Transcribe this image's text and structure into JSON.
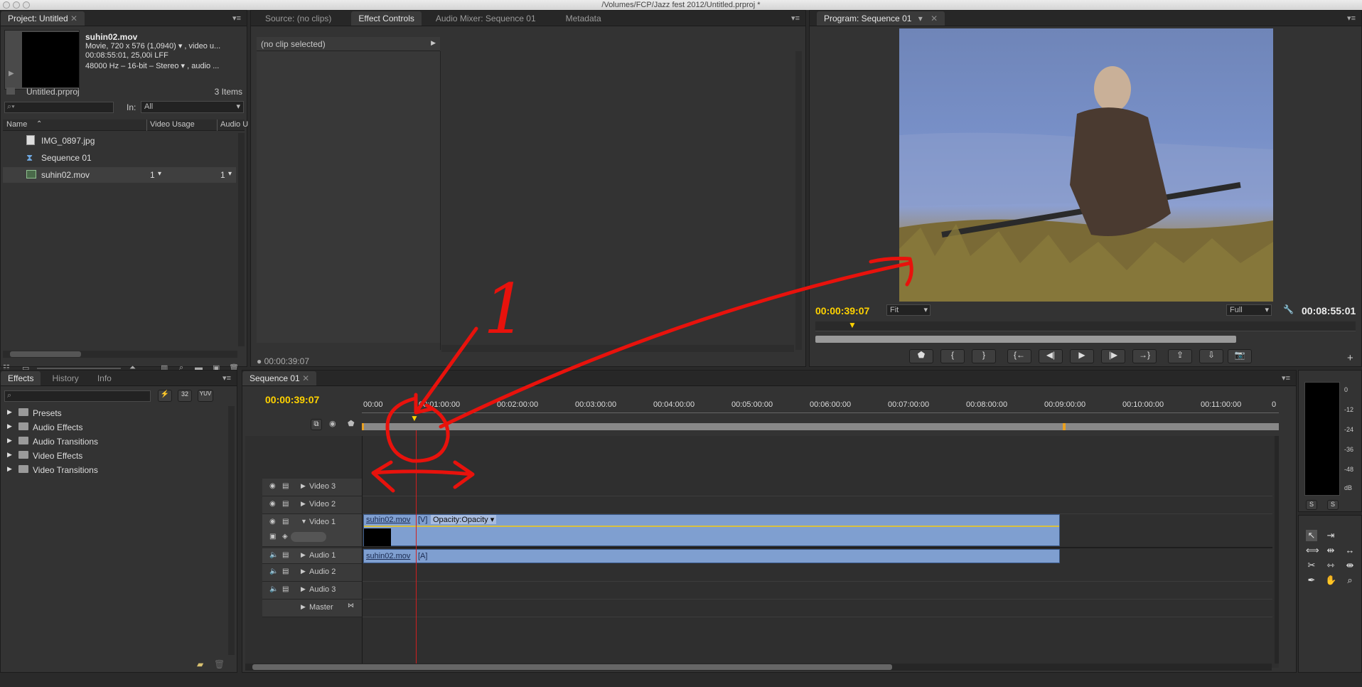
{
  "window": {
    "title": "/Volumes/FCP/Jazz fest 2012/Untitled.prproj *"
  },
  "project": {
    "tab": "Project: Untitled",
    "clip_name": "suhin02.mov",
    "clip_info1": "Movie, 720 x 576 (1,0940) ▾ , video u...",
    "clip_info2": "00:08:55:01, 25,00i LFF",
    "clip_info3": "48000 Hz – 16-bit – Stereo ▾ , audio ...",
    "filename": "Untitled.prproj",
    "item_count": "3 Items",
    "in_label": "In:",
    "in_value": "All",
    "columns": [
      "Name",
      "Video Usage",
      "Audio U"
    ],
    "items": [
      {
        "name": "IMG_0897.jpg",
        "video_usage": "",
        "audio_usage": ""
      },
      {
        "name": "Sequence 01",
        "video_usage": "",
        "audio_usage": ""
      },
      {
        "name": "suhin02.mov",
        "video_usage": "1",
        "audio_usage": "1"
      }
    ]
  },
  "source_panel": {
    "tabs": [
      "Source: (no clips)",
      "Effect Controls",
      "Audio Mixer: Sequence 01",
      "Metadata"
    ],
    "no_clip": "(no clip selected)",
    "timecode": "00:00:39:07"
  },
  "program": {
    "tab": "Program: Sequence 01",
    "timecode": "00:00:39:07",
    "fit": "Fit",
    "quality": "Full",
    "duration": "00:08:55:01"
  },
  "effects": {
    "tabs": [
      "Effects",
      "History",
      "Info"
    ],
    "btn1": "32",
    "btn2": "YUV",
    "folders": [
      "Presets",
      "Audio Effects",
      "Audio Transitions",
      "Video Effects",
      "Video Transitions"
    ]
  },
  "timeline": {
    "tab": "Sequence 01",
    "timecode": "00:00:39:07",
    "ruler": [
      "00:00",
      "00:01:00:00",
      "00:02:00:00",
      "00:03:00:00",
      "00:04:00:00",
      "00:05:00:00",
      "00:06:00:00",
      "00:07:00:00",
      "00:08:00:00",
      "00:09:00:00",
      "00:10:00:00",
      "00:11:00:00",
      "0"
    ],
    "tracks": {
      "video3": "Video 3",
      "video2": "Video 2",
      "video1": "Video 1",
      "audio1": "Audio 1",
      "audio2": "Audio 2",
      "audio3": "Audio 3",
      "master": "Master"
    },
    "video_clip": {
      "name": "suhin02.mov",
      "tag": "[V]",
      "effect": "Opacity:Opacity ▾"
    },
    "audio_clip": {
      "name": "suhin02.mov",
      "tag": "[A]"
    }
  },
  "meter": {
    "labels": [
      "0",
      "-12",
      "-24",
      "-36",
      "-48",
      "dB"
    ],
    "solo1": "S",
    "solo2": "S"
  },
  "annotation": {
    "number": "1",
    "color": "#e8120c"
  },
  "colors": {
    "accent_yellow": "#ffd200",
    "clip_blue": "#7f9fd0",
    "playhead": "#d02020"
  }
}
